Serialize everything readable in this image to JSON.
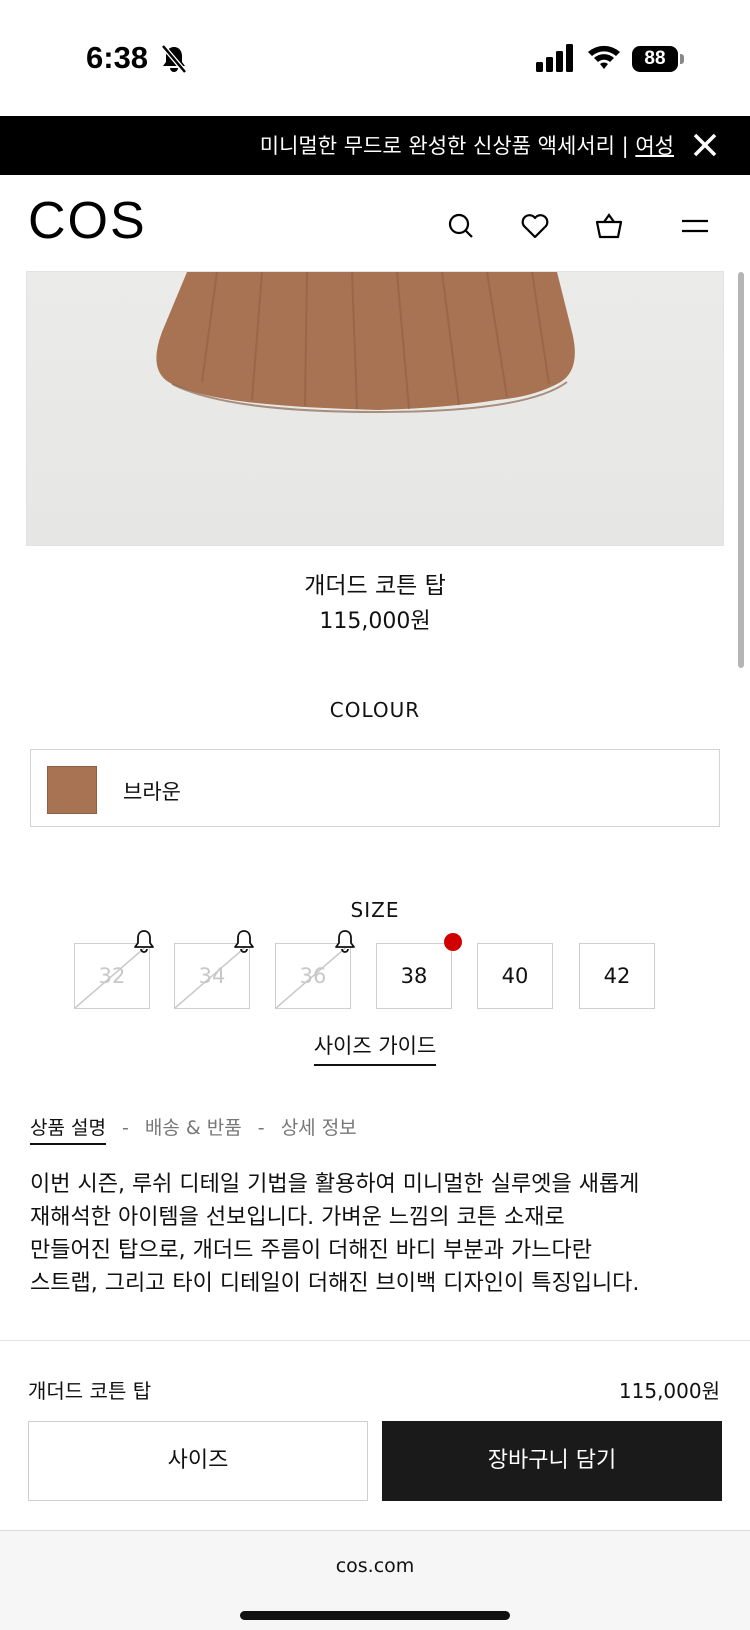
{
  "status_bar": {
    "time": "6:38",
    "battery": "88"
  },
  "promo": {
    "text": "미니멀한 무드로 완성한 신상품 액세서리 | ",
    "link": "여성"
  },
  "header": {
    "logo": "COS"
  },
  "product": {
    "name": "개더드 코튼 탑",
    "price": "115,000원",
    "image_color": "#a87352"
  },
  "colour": {
    "label": "COLOUR",
    "selected": "브라운",
    "swatch_color": "#a87352"
  },
  "size": {
    "label": "SIZE",
    "options": [
      {
        "value": "32",
        "available": false,
        "notify": true
      },
      {
        "value": "34",
        "available": false,
        "notify": true
      },
      {
        "value": "36",
        "available": false,
        "notify": true
      },
      {
        "value": "38",
        "available": true,
        "notify": false
      },
      {
        "value": "40",
        "available": true,
        "notify": false
      },
      {
        "value": "42",
        "available": true,
        "notify": false
      }
    ],
    "guide": "사이즈 가이드"
  },
  "tabs": {
    "active": "상품 설명",
    "items": [
      "배송 & 반품",
      "상세 정보"
    ],
    "separator": "-"
  },
  "description": {
    "lines": [
      "이번 시즌, 루쉬 디테일 기법을 활용하여 미니멀한 실루엣을 새롭게",
      "재해석한 아이템을 선보입니다. 가벼운 느낌의 코튼 소재로",
      "만들어진 탑으로, 개더드 주름이 더해진 바디 부분과 가느다란",
      "스트랩, 그리고 타이 디테일이 더해진 브이백 디자인이 특징입니다."
    ]
  },
  "sticky_bar": {
    "name": "개더드 코튼 탑",
    "price": "115,000원",
    "size_button": "사이즈",
    "cart_button": "장바구니 담기"
  },
  "browser": {
    "url": "cos.com"
  },
  "colors": {
    "accent": "#1a1a1a",
    "notify_dot": "#d10000"
  }
}
